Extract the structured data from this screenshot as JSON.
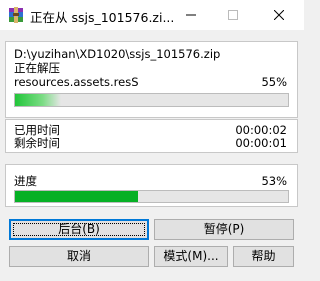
{
  "window": {
    "title": "正在从 ssjs_101576.zi...",
    "icon": "winrar-archive-icon"
  },
  "archive": {
    "path": "D:\\yuzihan\\XD1020\\ssjs_101576.zip",
    "status": "正在解压",
    "current_file": "resources.assets.resS",
    "file_percent_text": "55%",
    "file_progress": 0.17
  },
  "time": {
    "elapsed_label": "已用时间",
    "elapsed_value": "00:00:02",
    "remaining_label": "剩余时间",
    "remaining_value": "00:00:01"
  },
  "overall": {
    "label": "进度",
    "percent_text": "53%",
    "progress": 0.45
  },
  "buttons": {
    "background": "后台(B)",
    "pause": "暂停(P)",
    "cancel": "取消",
    "mode": "模式(M)...",
    "help": "帮助"
  },
  "colors": {
    "progress_green": "#06b025",
    "default_button_border": "#0078d7"
  }
}
